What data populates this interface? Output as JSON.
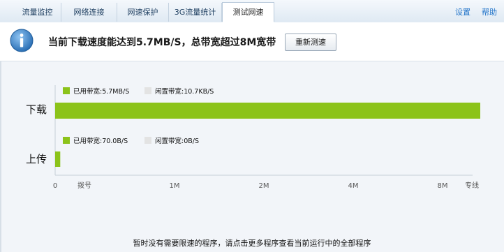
{
  "tabs": [
    {
      "label": "流量监控",
      "active": false
    },
    {
      "label": "网络连接",
      "active": false
    },
    {
      "label": "网速保护",
      "active": false
    },
    {
      "label": "3G流量统计",
      "active": false
    },
    {
      "label": "测试网速",
      "active": true
    }
  ],
  "toplinks": {
    "settings": "设置",
    "help": "帮助"
  },
  "info": {
    "headline": "当前下载速度能达到5.7MB/S，总带宽超过8M宽带",
    "retest_label": "重新测速",
    "icon": "info-icon"
  },
  "chart_data": {
    "type": "bar",
    "orientation": "horizontal",
    "categories": [
      "下载",
      "上传"
    ],
    "x_ticks": [
      "0",
      "拨号",
      "1M",
      "2M",
      "4M",
      "8M",
      "专线"
    ],
    "series": [
      {
        "name": "已用带宽",
        "color": "#8cc31a",
        "values_text": [
          "5.7MB/S",
          "70.0B/S"
        ],
        "fraction_of_scale": [
          1.0,
          0.012
        ]
      },
      {
        "name": "闲置带宽",
        "color": "#e3e3e3",
        "values_text": [
          "10.7KB/S",
          "0B/S"
        ]
      }
    ],
    "legends": [
      {
        "used_label": "已用带宽:5.7MB/S",
        "idle_label": "闲置带宽:10.7KB/S"
      },
      {
        "used_label": "已用带宽:70.0B/S",
        "idle_label": "闲置带宽:0B/S"
      }
    ],
    "grid": false
  },
  "footer": {
    "note": "暂时没有需要限速的程序，请点击更多程序查看当前运行中的全部程序"
  }
}
